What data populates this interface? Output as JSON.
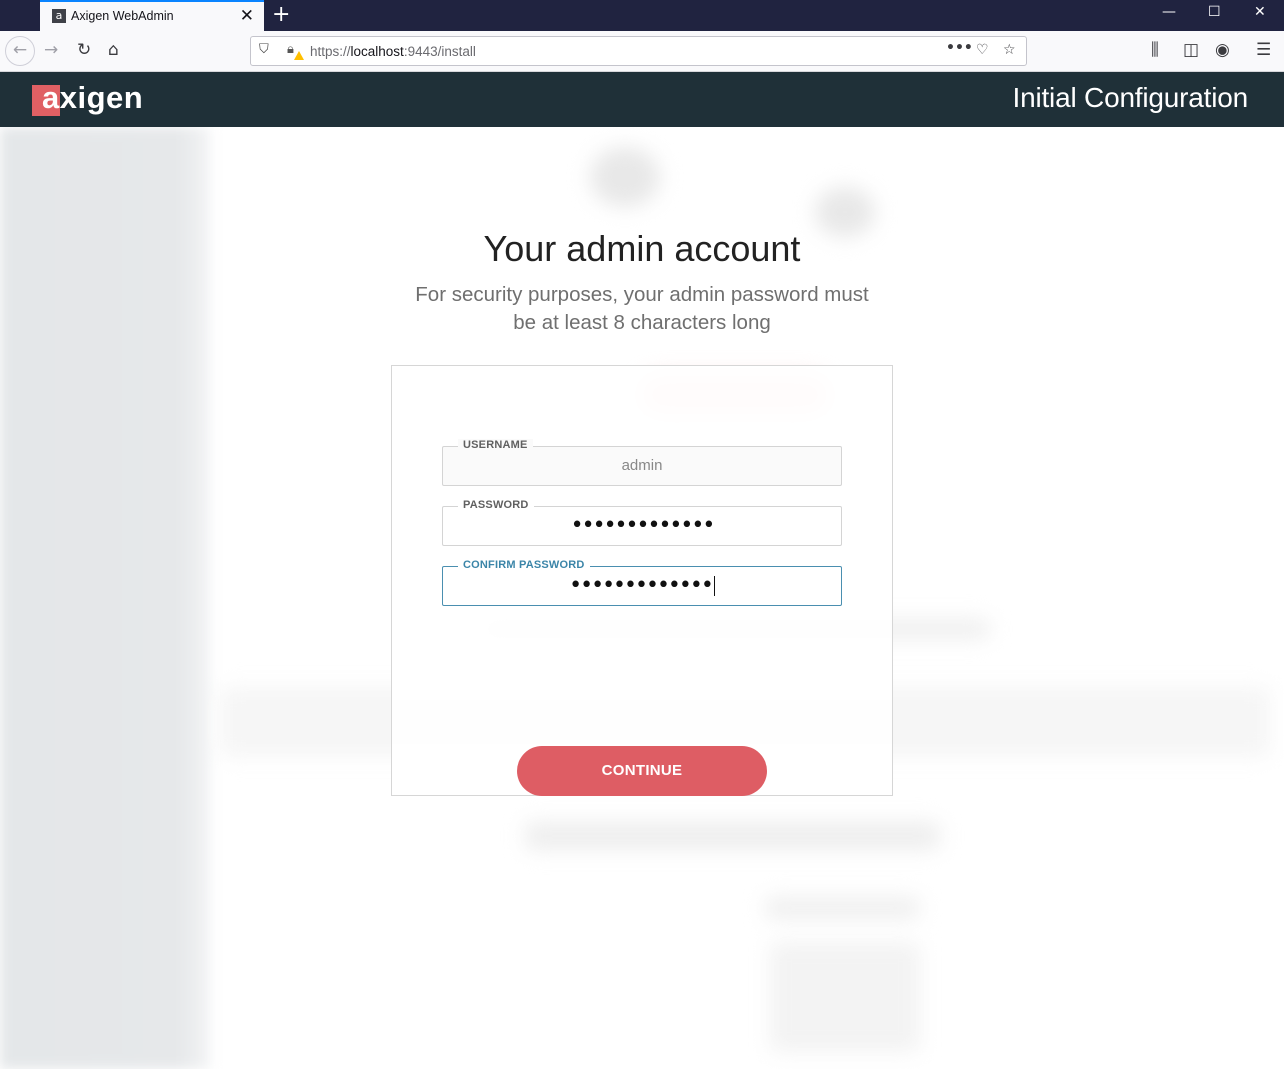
{
  "browser": {
    "tab_title": "Axigen WebAdmin",
    "tab_close": "✕",
    "new_tab": "+",
    "url_scheme": "https://",
    "url_host": "localhost",
    "url_rest": ":9443/install",
    "window_controls": {
      "minimize": "—",
      "maximize": "☐",
      "close": "✕"
    }
  },
  "app": {
    "logo_text": "axigen",
    "header_title": "Initial Configuration"
  },
  "page": {
    "heading": "Your admin account",
    "subtitle_line1": "For security purposes, your admin password must",
    "subtitle_line2": "be at least 8 characters long"
  },
  "form": {
    "username": {
      "label": "USERNAME",
      "value": "admin"
    },
    "password": {
      "label": "PASSWORD",
      "value": "•••••••••••••"
    },
    "confirm_password": {
      "label": "CONFIRM PASSWORD",
      "value": "•••••••••••••"
    },
    "continue_label": "CONTINUE"
  },
  "colors": {
    "header_bg": "#1f3038",
    "accent": "#de5d64",
    "focus_border": "#4a8fb0"
  }
}
